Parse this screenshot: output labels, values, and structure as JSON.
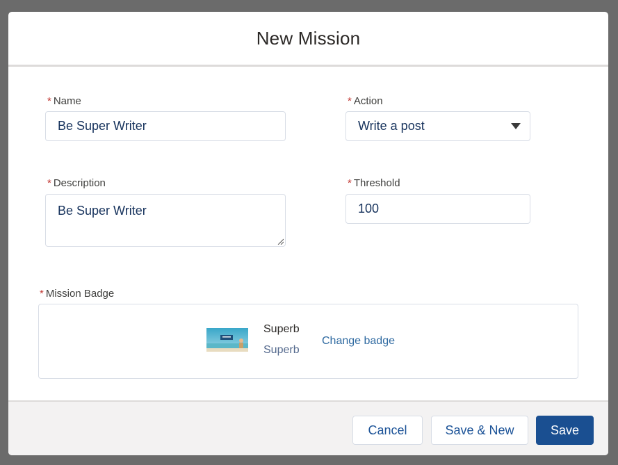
{
  "modal": {
    "title": "New Mission"
  },
  "form": {
    "required_marker": "*",
    "name": {
      "label": "Name",
      "value": "Be Super Writer"
    },
    "action": {
      "label": "Action",
      "value": "Write a post"
    },
    "description": {
      "label": "Description",
      "value": "Be Super Writer"
    },
    "threshold": {
      "label": "Threshold",
      "value": "100"
    },
    "mission_badge": {
      "label": "Mission Badge",
      "badge_name": "Superb",
      "badge_description": "Superb",
      "change_link": "Change badge"
    }
  },
  "footer": {
    "cancel_label": "Cancel",
    "save_new_label": "Save & New",
    "save_label": "Save"
  },
  "colors": {
    "brand": "#1a4f91",
    "required": "#c23934",
    "link": "#2f6aa1"
  },
  "icons": {
    "select_arrow": "chevron-down-icon",
    "resize": "resize-grip-icon"
  }
}
